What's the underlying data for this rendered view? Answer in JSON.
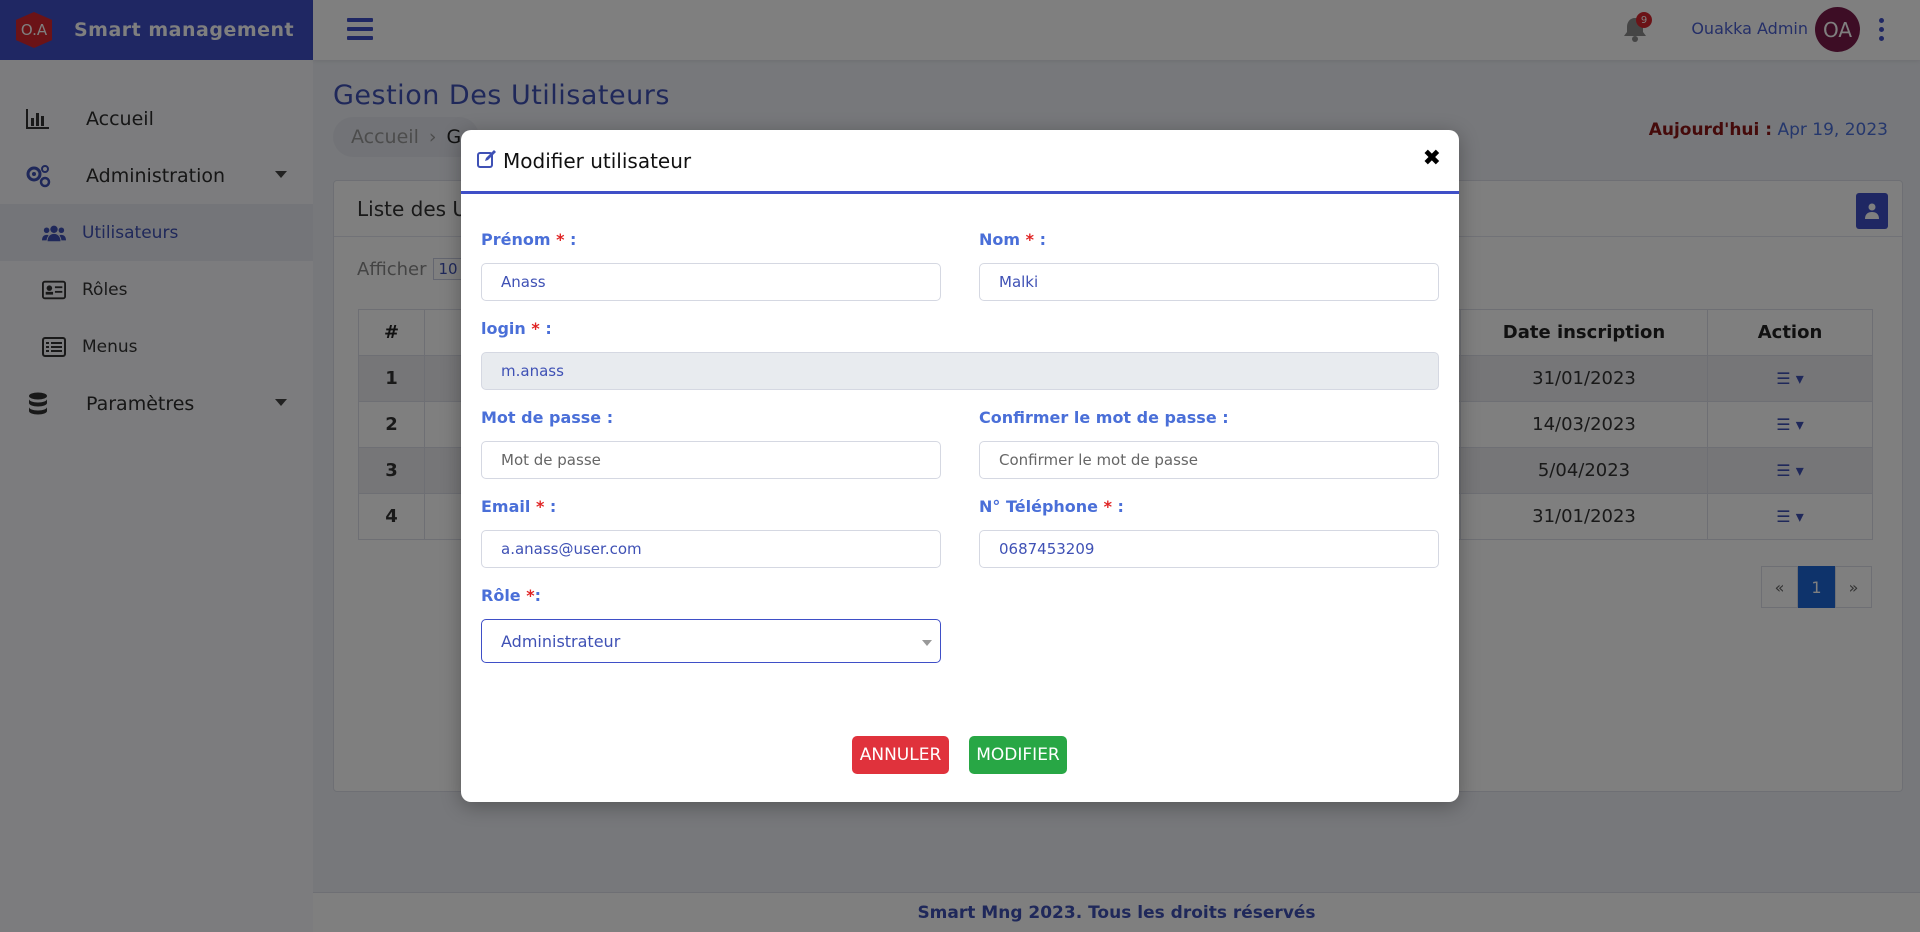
{
  "brand": {
    "logo_text": "O.A",
    "name": "Smart management"
  },
  "sidebar": {
    "items": [
      {
        "label": "Accueil",
        "icon": "bar-chart-icon"
      },
      {
        "label": "Administration",
        "icon": "cogs-icon"
      },
      {
        "label": "Utilisateurs",
        "icon": "users-icon"
      },
      {
        "label": "Rôles",
        "icon": "id-card-icon"
      },
      {
        "label": "Menus",
        "icon": "list-icon"
      },
      {
        "label": "Paramètres",
        "icon": "database-icon"
      }
    ]
  },
  "topbar": {
    "notification_count": "9",
    "user_name": "Ouakka Admin",
    "avatar_initials": "OA"
  },
  "page": {
    "title": "Gestion Des Utilisateurs",
    "breadcrumb": [
      "Accueil",
      "G"
    ],
    "today_label": "Aujourd'hui :",
    "today_value": "Apr 19, 2023",
    "card_title": "Liste des U",
    "show_label": "Afficher",
    "show_value": "10"
  },
  "table": {
    "headers": [
      "#",
      "Date inscription",
      "Action"
    ],
    "rows": [
      {
        "n": "1",
        "date": "31/01/2023"
      },
      {
        "n": "2",
        "date": "14/03/2023"
      },
      {
        "n": "3",
        "date": "5/04/2023"
      },
      {
        "n": "4",
        "date": "31/01/2023"
      }
    ]
  },
  "pagination": {
    "prev": "«",
    "current": "1",
    "next": "»"
  },
  "footer": "Smart Mng 2023. Tous les droits réservés",
  "modal": {
    "title": "Modifier utilisateur",
    "close": "✖",
    "prenom": {
      "label": "Prénom",
      "value": "Anass"
    },
    "nom": {
      "label": "Nom",
      "value": "Malki"
    },
    "login": {
      "label": "login",
      "value": "m.anass"
    },
    "password": {
      "label": "Mot de passe :",
      "placeholder": "Mot de passe"
    },
    "confirm": {
      "label": "Confirmer le mot de passe :",
      "placeholder": "Confirmer le mot de passe"
    },
    "email": {
      "label": "Email",
      "value": "a.anass@user.com"
    },
    "phone": {
      "label": "N° Téléphone",
      "value": "0687453209"
    },
    "role": {
      "label": "Rôle",
      "value": "Administrateur"
    },
    "cancel": "ANNULER",
    "submit": "MODIFIER"
  }
}
